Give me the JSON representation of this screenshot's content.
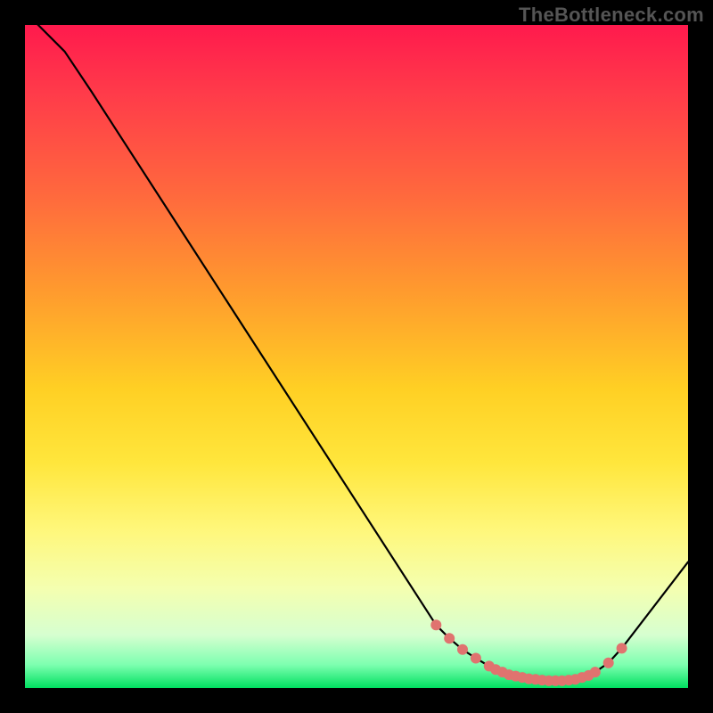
{
  "watermark": "TheBottleneck.com",
  "chart_data": {
    "type": "line",
    "title": "",
    "xlabel": "",
    "ylabel": "",
    "x": [
      0.0,
      0.06,
      0.1,
      0.62,
      0.64,
      0.66,
      0.68,
      0.7,
      0.72,
      0.74,
      0.76,
      0.78,
      0.8,
      0.82,
      0.84,
      0.86,
      0.88,
      0.9,
      1.0
    ],
    "y": [
      1.02,
      0.96,
      0.9,
      0.095,
      0.075,
      0.058,
      0.045,
      0.033,
      0.024,
      0.018,
      0.014,
      0.012,
      0.011,
      0.012,
      0.016,
      0.024,
      0.038,
      0.06,
      0.19
    ],
    "xlim": [
      0,
      1
    ],
    "ylim": [
      0,
      1
    ],
    "markers_x": [
      0.62,
      0.64,
      0.66,
      0.68,
      0.7,
      0.71,
      0.72,
      0.73,
      0.74,
      0.75,
      0.76,
      0.77,
      0.78,
      0.79,
      0.8,
      0.81,
      0.82,
      0.83,
      0.84,
      0.85,
      0.86,
      0.88,
      0.9
    ],
    "markers_y": [
      0.095,
      0.075,
      0.058,
      0.045,
      0.033,
      0.028,
      0.024,
      0.02,
      0.018,
      0.016,
      0.014,
      0.013,
      0.012,
      0.011,
      0.011,
      0.011,
      0.012,
      0.013,
      0.016,
      0.019,
      0.024,
      0.038,
      0.06
    ],
    "background_gradient": {
      "top": "#ff1a4d",
      "mid": "#ffe63c",
      "bottom": "#00e060"
    },
    "marker_color": "#e0736f"
  }
}
